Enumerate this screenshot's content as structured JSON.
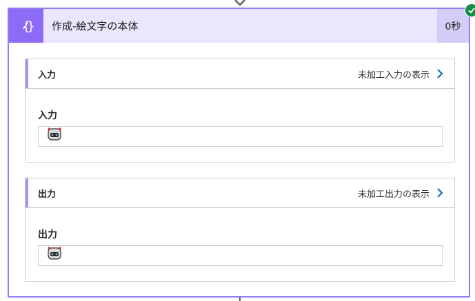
{
  "action": {
    "title": "作成-絵文字の本体",
    "duration": "0秒",
    "icon": "variable-braces-icon",
    "status": "succeeded"
  },
  "sections": {
    "input": {
      "header": "入力",
      "raw_link": "未加工入力の表示",
      "field_label": "入力",
      "field_value_icon": "robot-emoji"
    },
    "output": {
      "header": "出力",
      "raw_link": "未加工出力の表示",
      "field_label": "出力",
      "field_value_icon": "robot-emoji"
    }
  },
  "colors": {
    "accent": "#8c6cf6",
    "header_bg": "#ebe6fd",
    "duration_bg": "#d4cdf7",
    "border": "#8f7cf1",
    "success": "#138e46",
    "link_chevron": "#0f6cbd"
  }
}
